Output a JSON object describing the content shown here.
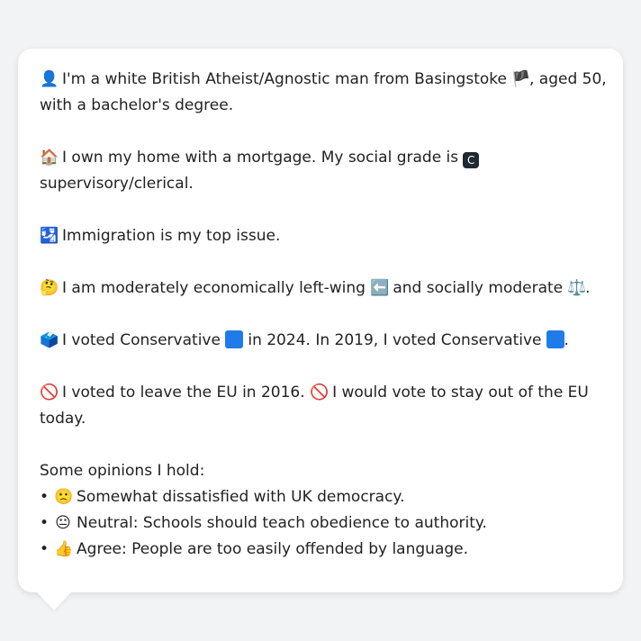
{
  "message": {
    "identity": {
      "emoji": "👤",
      "text_1": "I'm a white British Atheist/Agnostic man from Basingstoke",
      "flag": "🏴",
      "text_2": ", aged 50,",
      "text_3": "with a bachelor's degree."
    },
    "home": {
      "emoji": "🏠",
      "text_1": "I own my home with a mortgage. My social grade is",
      "badge": "C",
      "text_2": "supervisory/clerical."
    },
    "issue": {
      "emoji": "🛂",
      "text": "Immigration is my top issue."
    },
    "ideology": {
      "emoji": "🤔",
      "text_1": "I am moderately economically left-wing",
      "left_emoji": "⬅️",
      "text_2": "and socially moderate",
      "scale_emoji": "⚖️",
      "text_3": "."
    },
    "vote": {
      "emoji": "🗳️",
      "text_1": "I voted Conservative",
      "text_2": "in 2024. In 2019, I voted Conservative",
      "text_3": ".",
      "party_color": "#1e7be8"
    },
    "eu": {
      "emoji": "🚫",
      "text_1": "I voted to leave the EU in 2016.",
      "emoji_2": "🚫",
      "text_2": "I would vote to stay out of the EU",
      "text_3": "today."
    },
    "opinions": {
      "heading": "Some opinions I hold:",
      "bullet": "•",
      "items": [
        {
          "emoji": "🙁",
          "text": "Somewhat dissatisfied with UK democracy."
        },
        {
          "emoji": "😐",
          "text": "Neutral: Schools should teach obedience to authority."
        },
        {
          "emoji": "👍",
          "text": "Agree: People are too easily offended by language."
        }
      ]
    }
  }
}
